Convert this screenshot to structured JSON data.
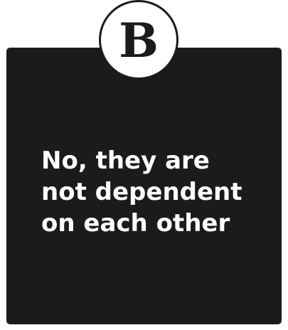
{
  "logo": {
    "letter": "B",
    "icon": "b-logo-icon"
  },
  "card": {
    "lines": [
      "No, they are",
      "not dependent",
      "on each other"
    ]
  },
  "colors": {
    "card_background": "#1b1b1b",
    "text": "#ffffff",
    "badge_background": "#ffffff"
  }
}
